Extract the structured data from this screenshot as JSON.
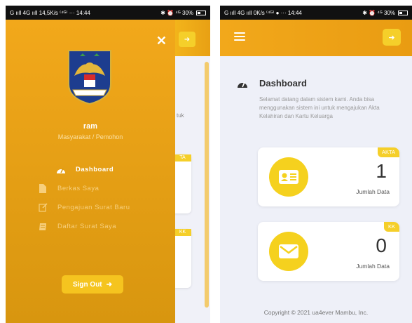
{
  "left": {
    "status": {
      "left": "G ııll 4G ııll 14,5K/s ⁽⁴ᴳ⁾ ···   14:44",
      "right": "✱ ⏰ ⁴ᴳ 30%"
    },
    "background": {
      "fragment_text": "tuk",
      "badge_akta": "TA",
      "badge_kk": "KK"
    },
    "drawer": {
      "user_name": "ram",
      "user_role": "Masyarakat / Pemohon",
      "menu": [
        {
          "label": "Dashboard",
          "icon": "dashboard-icon"
        },
        {
          "label": "Berkas Saya",
          "icon": "file-icon"
        },
        {
          "label": "Pengajuan Surat Baru",
          "icon": "edit-icon"
        },
        {
          "label": "Daftar Surat Saya",
          "icon": "book-icon"
        }
      ],
      "signout_label": "Sign Out"
    }
  },
  "right": {
    "status": {
      "left": "G ııll 4G ııll 0K/s ⁽⁴ᴳ⁾ ● ···   14:44",
      "right": "✱ ⏰ ⁴ᴳ 30%"
    },
    "dashboard": {
      "title": "Dashboard",
      "description": "Selamat datang dalam sistem kami. Anda bisa menggunakan sistem ini untuk mengajukan Akta Kelahiran dan Kartu Keluarga"
    },
    "cards": [
      {
        "badge": "AKTA",
        "value": "1",
        "label": "Jumlah Data",
        "icon": "id-card-icon"
      },
      {
        "badge": "KK",
        "value": "0",
        "label": "Jumlah Data",
        "icon": "envelope-icon"
      }
    ],
    "copyright": "Copyright © 2021 ua4ever Mambu, Inc."
  },
  "colors": {
    "primary": "#f2a81b",
    "accent": "#f5cf2a"
  }
}
